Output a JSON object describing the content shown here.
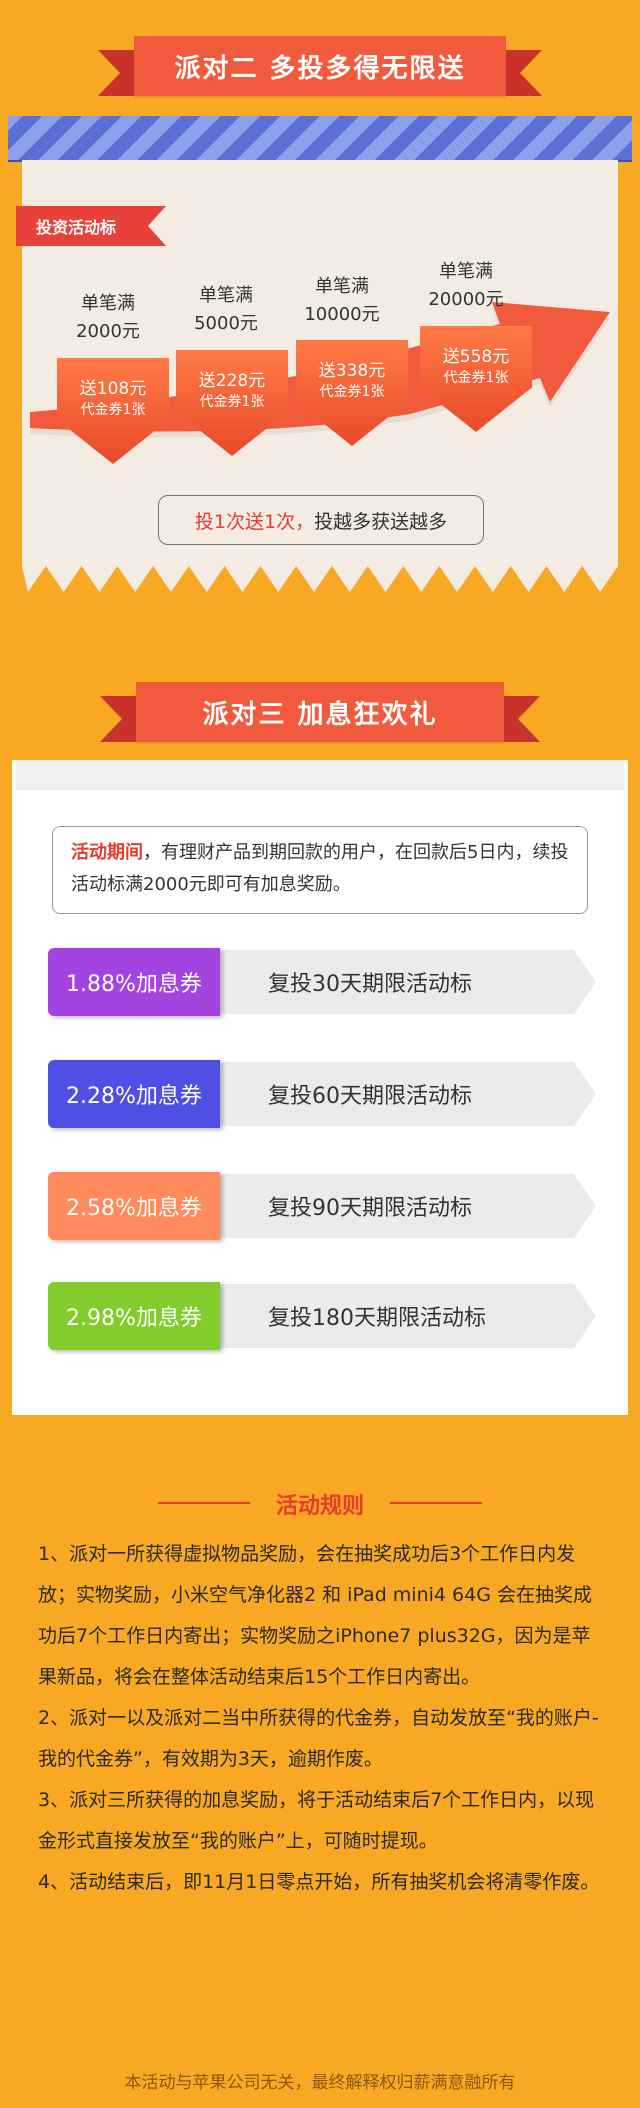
{
  "party2": {
    "title": "派对二  多投多得无限送",
    "tag": "投资活动标",
    "tiers": [
      {
        "label1": "单笔满",
        "label2": "2000元",
        "reward": "送108元",
        "reward2": "代金券1张"
      },
      {
        "label1": "单笔满",
        "label2": "5000元",
        "reward": "送228元",
        "reward2": "代金券1张"
      },
      {
        "label1": "单笔满",
        "label2": "10000元",
        "reward": "送338元",
        "reward2": "代金券1张"
      },
      {
        "label1": "单笔满",
        "label2": "20000元",
        "reward": "送558元",
        "reward2": "代金券1张"
      }
    ],
    "slogan_red": "投1次送1次，",
    "slogan_dark": "投越多获送越多"
  },
  "party3": {
    "title": "派对三   加息狂欢礼",
    "desc_highlight": "活动期间",
    "desc_text": "，有理财产品到期回款的用户，在回款后5日内，续投活动标满2000元即可有加息奖励。",
    "coupons": [
      {
        "rate": "1.88%加息券",
        "term": "复投30天期限活动标",
        "color": "#a344e0"
      },
      {
        "rate": "2.28%加息券",
        "term": "复投60天期限活动标",
        "color": "#4f4fe6"
      },
      {
        "rate": "2.58%加息券",
        "term": "复投90天期限活动标",
        "color": "#ff8a5c"
      },
      {
        "rate": "2.98%加息券",
        "term": "复投180天期限活动标",
        "color": "#82cc2c"
      }
    ]
  },
  "rules": {
    "title": "活动规则",
    "items": [
      "1、派对一所获得虚拟物品奖励，会在抽奖成功后3个工作日内发放；实物奖励，小米空气净化器2 和 iPad mini4 64G 会在抽奖成功后7个工作日内寄出；实物奖励之iPhone7 plus32G，因为是苹果新品，将会在整体活动结束后15个工作日内寄出。",
      "2、派对一以及派对二当中所获得的代金券，自动发放至“我的账户-我的代金券”，有效期为3天，逾期作废。",
      "3、派对三所获得的加息奖励，将于活动结束后7个工作日内，以现金形式直接发放至“我的账户”上，可随时提现。",
      "4、活动结束后，即11月1日零点开始，所有抽奖机会将清零作废。"
    ]
  },
  "footer": "本活动与苹果公司无关，最终解释权归薪满意融所有"
}
